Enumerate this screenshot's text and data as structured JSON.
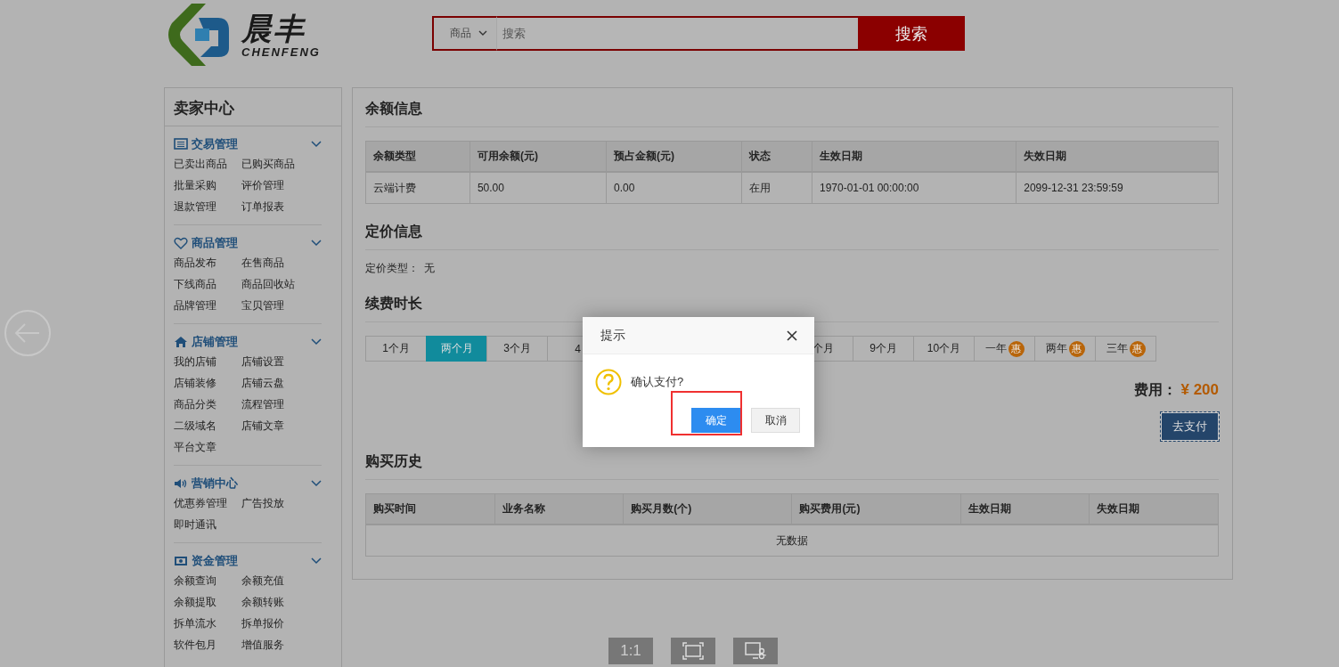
{
  "logo": {
    "name": "晨丰",
    "subtitle": "CHENFENG"
  },
  "search": {
    "category": "商品",
    "placeholder": "搜索",
    "button": "搜索"
  },
  "sidebar": {
    "title": "卖家中心",
    "sections": [
      {
        "kind": "list",
        "title": "交易管理",
        "items": [
          "已卖出商品",
          "已购买商品",
          "批量采购",
          "评价管理",
          "退款管理",
          "订单报表"
        ]
      },
      {
        "kind": "heart",
        "title": "商品管理",
        "items": [
          "商品发布",
          "在售商品",
          "下线商品",
          "商品回收站",
          "品牌管理",
          "宝贝管理"
        ]
      },
      {
        "kind": "home",
        "title": "店铺管理",
        "items": [
          "我的店铺",
          "店铺设置",
          "店铺装修",
          "店铺云盘",
          "商品分类",
          "流程管理",
          "二级域名",
          "店铺文章",
          "平台文章"
        ]
      },
      {
        "kind": "speaker",
        "title": "营销中心",
        "items": [
          "优惠券管理",
          "广告投放",
          "即时通讯"
        ]
      },
      {
        "kind": "money",
        "title": "资金管理",
        "items": [
          "余额查询",
          "余额充值",
          "余额提取",
          "余额转账",
          "拆单流水",
          "拆单报价",
          "软件包月",
          "增值服务"
        ]
      }
    ]
  },
  "balance": {
    "title": "余额信息",
    "columns": [
      "余额类型",
      "可用余额(元)",
      "预占金额(元)",
      "状态",
      "生效日期",
      "失效日期"
    ],
    "rows": [
      [
        "云端计费",
        "50.00",
        "0.00",
        "在用",
        "1970-01-01 00:00:00",
        "2099-12-31 23:59:59"
      ]
    ]
  },
  "pricing": {
    "title": "定价信息",
    "label": "定价类型：",
    "value": "无"
  },
  "renewal": {
    "title": "续费时长",
    "options": [
      {
        "label": "1个月",
        "selected": false
      },
      {
        "label": "两个月",
        "selected": true
      },
      {
        "label": "3个月",
        "selected": false
      },
      {
        "label": "4",
        "selected": false
      },
      {
        "label": "个月",
        "selected": false
      },
      {
        "label": "9个月",
        "selected": false
      },
      {
        "label": "10个月",
        "selected": false
      },
      {
        "label": "一年",
        "badge": "惠",
        "selected": false
      },
      {
        "label": "两年",
        "badge": "惠",
        "selected": false
      },
      {
        "label": "三年",
        "badge": "惠",
        "selected": false
      }
    ],
    "fee_label": "费用：",
    "fee": "¥ 200",
    "pay_button": "去支付"
  },
  "history": {
    "title": "购买历史",
    "columns": [
      "购买时间",
      "业务名称",
      "购买月数(个)",
      "购买费用(元)",
      "生效日期",
      "失效日期"
    ],
    "empty_text": "无数据"
  },
  "dialog": {
    "title": "提示",
    "message": "确认支付?",
    "buttons": [
      {
        "label": "确定",
        "kind": "primary",
        "highlighted": true
      },
      {
        "label": "取消",
        "kind": "default",
        "highlighted": false
      }
    ]
  },
  "viewer_toolbar": [
    {
      "kind": "text",
      "label": "1:1"
    },
    {
      "kind": "fit"
    },
    {
      "kind": "crop"
    }
  ]
}
